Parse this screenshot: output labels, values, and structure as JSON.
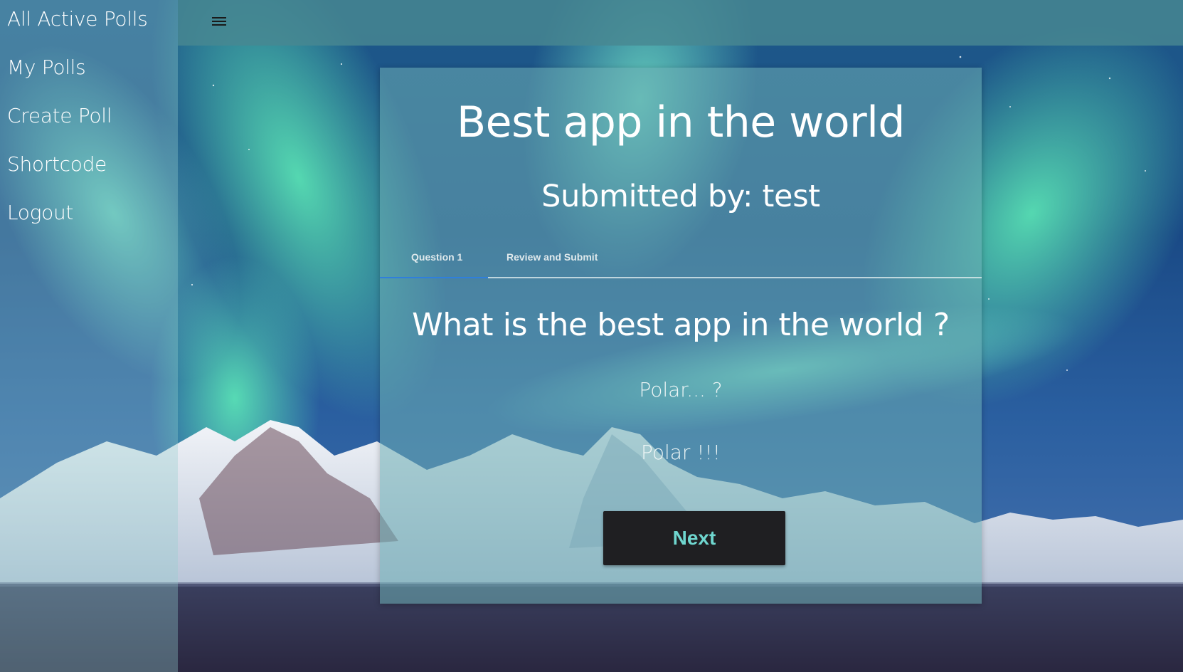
{
  "sidebar": {
    "items": [
      {
        "label": "All Active Polls"
      },
      {
        "label": "My Polls"
      },
      {
        "label": "Create Poll"
      },
      {
        "label": "Shortcode"
      },
      {
        "label": "Logout"
      }
    ]
  },
  "topbar": {
    "menu_icon": "hamburger-menu-icon"
  },
  "poll": {
    "title": "Best app in the world",
    "submitted_by": "Submitted by: test",
    "tabs": [
      {
        "label": "Question 1",
        "active": true
      },
      {
        "label": "Review and Submit",
        "active": false
      }
    ],
    "question": "What is the best app in the world ?",
    "options": [
      {
        "label": "Polar... ?"
      },
      {
        "label": "Polar !!!"
      }
    ],
    "next_label": "Next"
  },
  "colors": {
    "accent_tab": "#2f7fdc",
    "button_bg": "#1f1f22",
    "button_text": "#6fd6cf"
  }
}
